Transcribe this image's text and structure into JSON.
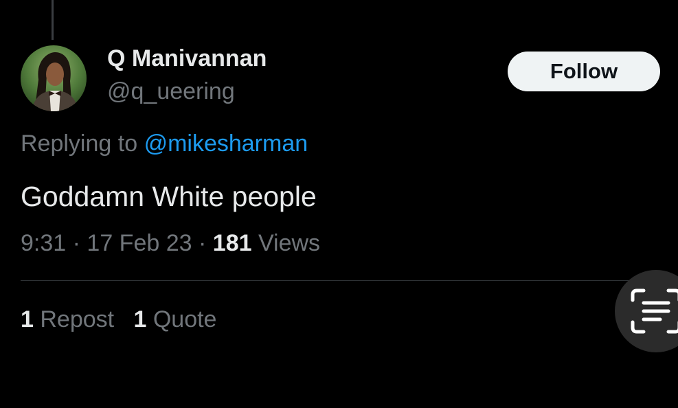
{
  "tweet": {
    "author": {
      "display_name": "Q Manivannan",
      "handle": "@q_ueering"
    },
    "follow_label": "Follow",
    "replying_prefix": "Replying to",
    "replying_to": "@mikesharman",
    "text": "Goddamn White people",
    "time": "9:31",
    "date": "17 Feb 23",
    "views_count": "181",
    "views_label": "Views",
    "separator": "·",
    "stats": {
      "reposts_count": "1",
      "reposts_label": "Repost",
      "quotes_count": "1",
      "quotes_label": "Quote"
    }
  },
  "overlay": {
    "icon": "text-scan-icon"
  },
  "colors": {
    "background": "#000000",
    "primary_text": "#e7e9ea",
    "secondary_text": "#71767b",
    "link": "#1d9bf0",
    "follow_bg": "#eff3f4",
    "divider": "#2f3336"
  }
}
